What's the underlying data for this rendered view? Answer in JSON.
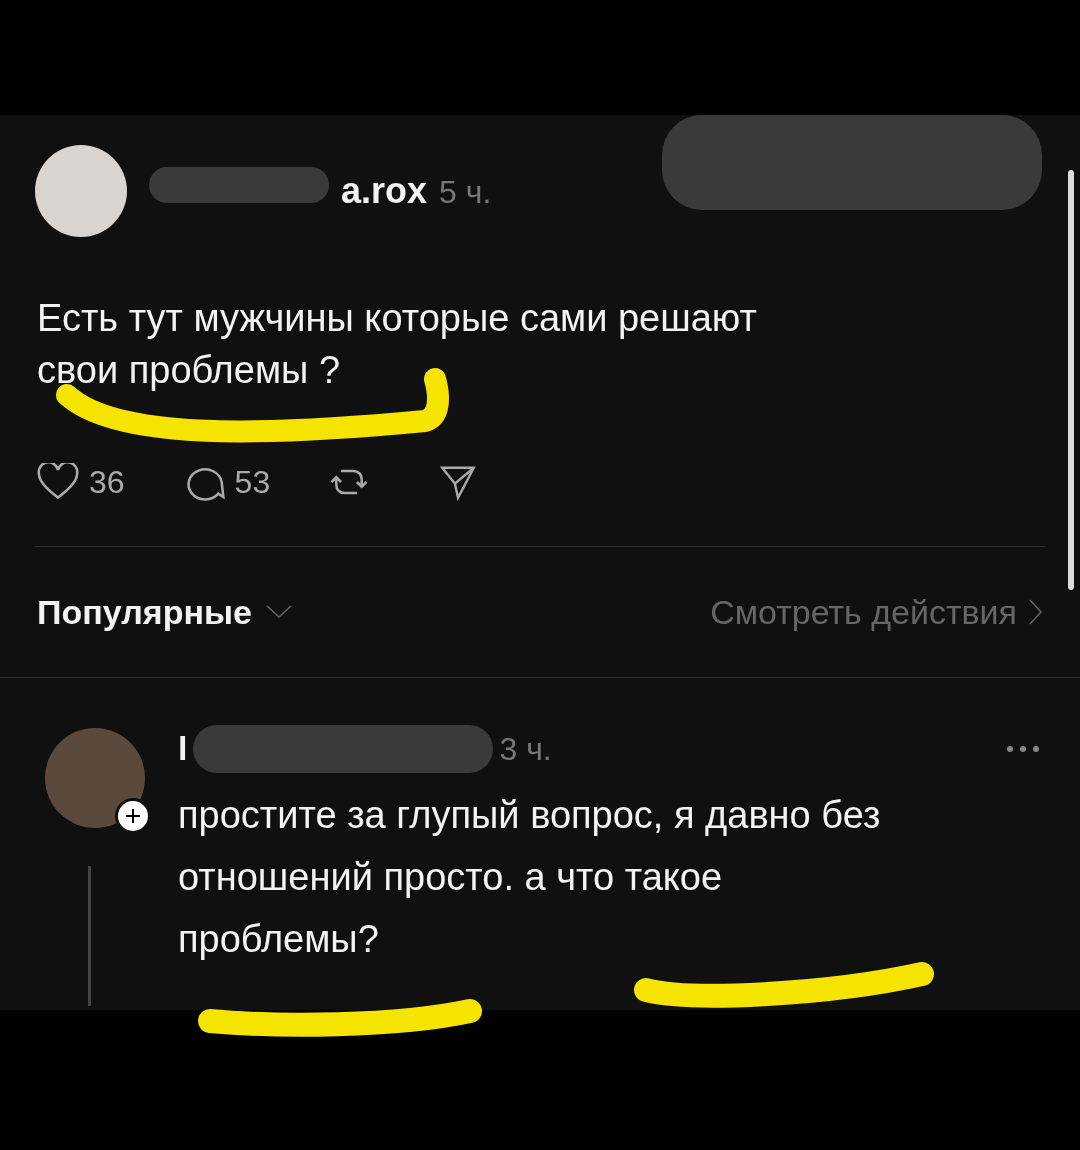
{
  "post": {
    "username": "a.rox",
    "time": "5 ч.",
    "text": "Есть тут мужчины которые сами решают свои проблемы ?",
    "likes": "36",
    "comments": "53"
  },
  "sort": {
    "label": "Популярные"
  },
  "activity_link": {
    "label": "Смотреть действия"
  },
  "reply": {
    "username": "l",
    "time": "3 ч.",
    "text": "простите за глупый вопрос, я давно без отношений просто. а что такое проблемы?"
  }
}
